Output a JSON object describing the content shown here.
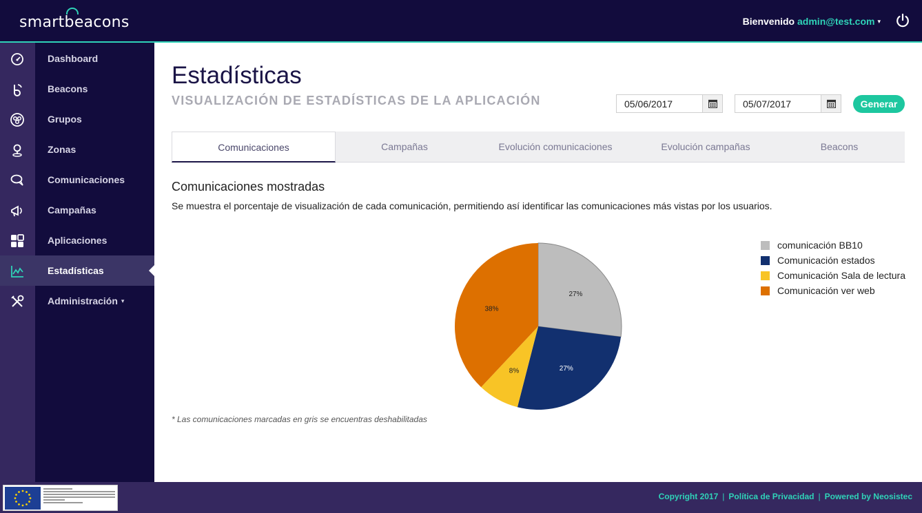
{
  "header": {
    "logo_prefix": "smart",
    "logo_b": "b",
    "logo_suffix": "eacons",
    "welcome_label": "Bienvenido",
    "user_email": "admin@test.com",
    "caret": "▾",
    "power_icon": "power-icon"
  },
  "sidebar": {
    "items": [
      {
        "label": "Dashboard",
        "icon": "gauge-icon"
      },
      {
        "label": "Beacons",
        "icon": "beacon-icon"
      },
      {
        "label": "Grupos",
        "icon": "groups-icon"
      },
      {
        "label": "Zonas",
        "icon": "location-pin-icon"
      },
      {
        "label": "Comunicaciones",
        "icon": "chat-icon"
      },
      {
        "label": "Campañas",
        "icon": "megaphone-icon"
      },
      {
        "label": "Aplicaciones",
        "icon": "grid-icon"
      },
      {
        "label": "Estadísticas",
        "icon": "line-chart-icon",
        "active": true
      },
      {
        "label": "Administración",
        "icon": "tools-icon",
        "has_caret": true
      }
    ],
    "caret": "▾"
  },
  "main": {
    "title": "Estadísticas",
    "subtitle": "VISUALIZACIÓN DE ESTADÍSTICAS DE LA APLICACIÓN",
    "date_from": "05/06/2017",
    "date_to": "05/07/2017",
    "generate_label": "Generar",
    "tabs": [
      {
        "label": "Comunicaciones",
        "active": true
      },
      {
        "label": "Campañas"
      },
      {
        "label": "Evolución comunicaciones"
      },
      {
        "label": "Evolución campañas"
      },
      {
        "label": "Beacons"
      }
    ],
    "section_title": "Comunicaciones mostradas",
    "section_desc": "Se muestra el porcentaje de visualización de cada comunicación, permitiendo así identificar las comunicaciones más vistas por los usuarios.",
    "footnote": "* Las comunicaciones marcadas en gris se encuentras deshabilitadas"
  },
  "chart_data": {
    "type": "pie",
    "categories": [
      "comunicación BB10",
      "Comunicación estados",
      "Comunicación Sala de lectura",
      "Comunicación ver web"
    ],
    "values": [
      27,
      27,
      8,
      38
    ],
    "labels": [
      "27%",
      "27%",
      "8%",
      "38%"
    ],
    "colors": [
      "#bdbdbd",
      "#12306f",
      "#f8c426",
      "#dd7000"
    ],
    "legend_position": "right"
  },
  "footer": {
    "copyright": "Copyright 2017",
    "privacy": "Política de Privacidad",
    "powered": "Powered by Neosistec",
    "separator": "|"
  }
}
